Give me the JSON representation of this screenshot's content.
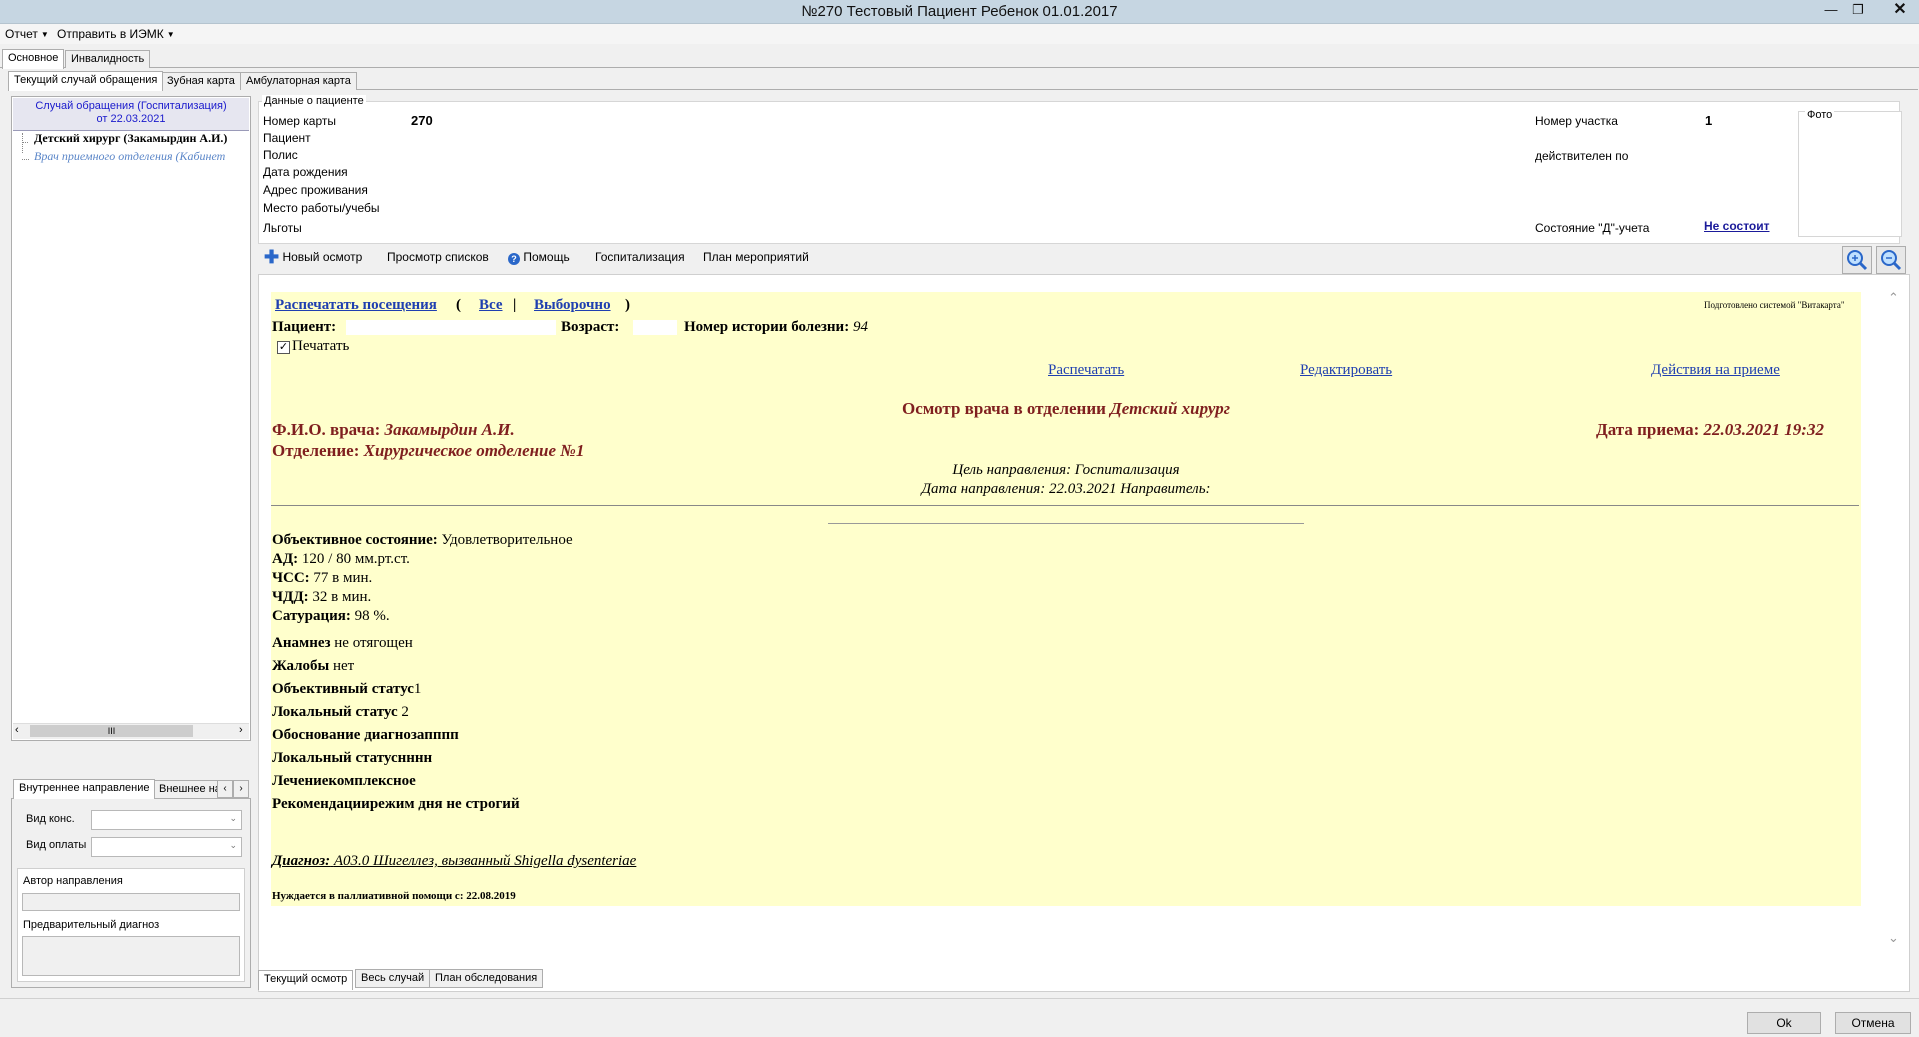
{
  "window": {
    "title": "№270 Тестовый Пациент Ребенок 01.01.2017"
  },
  "menu": [
    {
      "label": "Отчет"
    },
    {
      "label": "Отправить в ИЭМК"
    }
  ],
  "main_tabs": [
    "Основное",
    "Инвалидность"
  ],
  "sub_tabs": [
    "Текущий случай обращения",
    "Зубная карта",
    "Амбулаторная карта"
  ],
  "sidebar": {
    "case_header": "Случай обращения (Госпитализация)",
    "case_date": "от 22.03.2021",
    "tree": [
      "Детский хирург (Закамырдин А.И.)",
      "Врач приемного отделения (Кабинет"
    ],
    "scroll_mid": "III"
  },
  "referral": {
    "tabs": [
      "Внутреннее направление",
      "Внешнее на"
    ],
    "cons_type_label": "Вид конс.",
    "payment_type_label": "Вид оплаты",
    "author_label": "Автор направления",
    "prelim_diag_label": "Предварительный диагноз"
  },
  "patient": {
    "group_label": "Данные о пациенте",
    "card_number_label": "Номер карты",
    "card_number": "270",
    "patient_label": "Пациент",
    "policy_label": "Полис",
    "birth_label": "Дата рождения",
    "address_label": "Адрес проживания",
    "work_label": "Место работы/учебы",
    "benefits_label": "Льготы",
    "district_label": "Номер участка",
    "district": "1",
    "valid_label": "действителен по",
    "d_status_label": "Состояние \"Д\"-учета",
    "d_status": "Не состоит",
    "photo_label": "Фото"
  },
  "toolbar": {
    "new_exam": "Новый осмотр",
    "view_lists": "Просмотр списков",
    "help": "Помощь",
    "hosp": "Госпитализация",
    "plan": "План мероприятий"
  },
  "doc": {
    "print_visits": "Распечатать посещения",
    "all": "Все",
    "selective": "Выборочно",
    "prepared": "Подготовлено системой \"Витакарта\"",
    "patient_label": "Пациент:",
    "age_label": "Возраст:",
    "history_label": "Номер истории болезни:",
    "history_num": "94",
    "print_checkbox": "Печатать",
    "print_link": "Распечатать",
    "edit_link": "Редактировать",
    "actions_link": "Действия на приеме",
    "exam_title": "Осмотр врача в отделении",
    "exam_dept": "Детский хирург",
    "doctor_label": "Ф.И.О. врача:",
    "doctor": "Закамырдин А.И.",
    "dept_label": "Отделение:",
    "dept": "Хирургическое отделение №1",
    "date_label": "Дата приема:",
    "date": "22.03.2021 19:32",
    "purpose": "Цель направления: Госпитализация",
    "ref_date": "Дата направления: 22.03.2021 Направитель:",
    "obj_label": "Объективное состояние:",
    "obj": "Удовлетворительное",
    "bp_label": "АД:",
    "bp": "120 / 80 мм.рт.ст.",
    "hr_label": "ЧСС:",
    "hr": "77 в мин.",
    "rr_label": "ЧДД:",
    "rr": "32 в мин.",
    "sat_label": "Сатурация:",
    "sat": "98 %.",
    "anam_label": "Анамнез",
    "anam": "не отягощен",
    "compl_label": "Жалобы",
    "compl": "нет",
    "objst_label": "Объективный статус",
    "objst": "1",
    "loc_label": "Локальный статус",
    "loc": "2",
    "just": "Обоснование диагнозапппп",
    "loc2": "Локальный статуснннн",
    "treat": "Лечениекомплексное",
    "recom": "Рекомендациирежим дня не строгий",
    "diag_label": "Диагноз:",
    "diag": "A03.0 Шигеллез, вызванный Shigella dysenteriae",
    "palliative": "Нуждается в паллиативной помощи с: 22.08.2019"
  },
  "bottom_tabs": [
    "Текущий осмотр",
    "Весь случай",
    "План обследования"
  ],
  "buttons": {
    "ok": "Ok",
    "cancel": "Отмена"
  }
}
